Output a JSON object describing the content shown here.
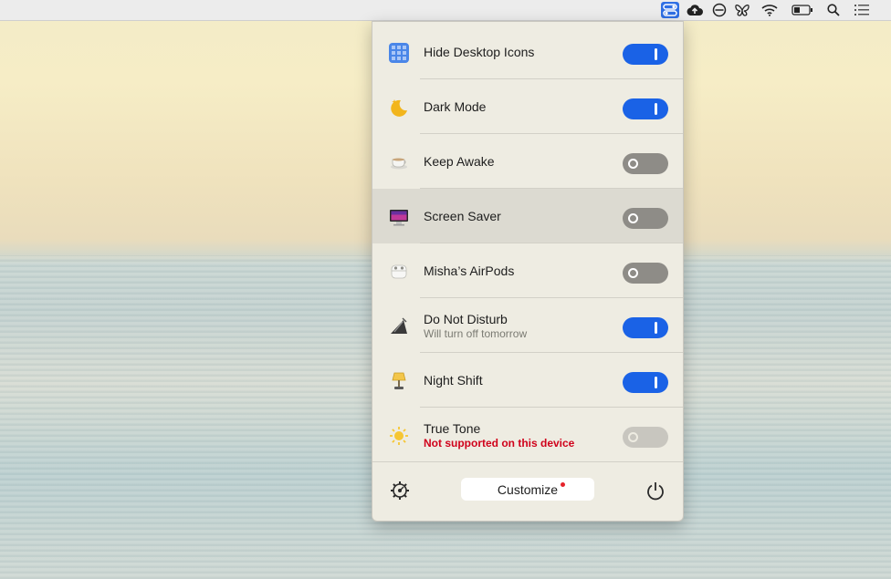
{
  "menubar": {
    "icons": [
      "toggles-icon",
      "cloud-upload-icon",
      "dnd-circle-icon",
      "butterfly-icon",
      "wifi-icon",
      "battery-icon",
      "search-icon",
      "menu-list-icon"
    ]
  },
  "panel": {
    "items": [
      {
        "title": "Hide Desktop Icons",
        "subtitle": "",
        "state": "on",
        "icon": "grid-icon"
      },
      {
        "title": "Dark Mode",
        "subtitle": "",
        "state": "on",
        "icon": "moon-icon"
      },
      {
        "title": "Keep Awake",
        "subtitle": "",
        "state": "off",
        "icon": "cup-icon"
      },
      {
        "title": "Screen Saver",
        "subtitle": "",
        "state": "off",
        "icon": "monitor-icon"
      },
      {
        "title": "Misha’s AirPods",
        "subtitle": "",
        "state": "off",
        "icon": "airpods-icon"
      },
      {
        "title": "Do Not Disturb",
        "subtitle": "Will turn off tomorrow",
        "state": "on",
        "icon": "dnd-icon"
      },
      {
        "title": "Night Shift",
        "subtitle": "",
        "state": "on",
        "icon": "lamp-icon"
      },
      {
        "title": "True Tone",
        "subtitle": "Not supported on this device",
        "state": "disabled",
        "icon": "sun-icon"
      }
    ],
    "customize_label": "Customize"
  },
  "colors": {
    "accent": "#1a62e6",
    "warning": "#d0021b",
    "panel_bg": "#eeece2"
  }
}
